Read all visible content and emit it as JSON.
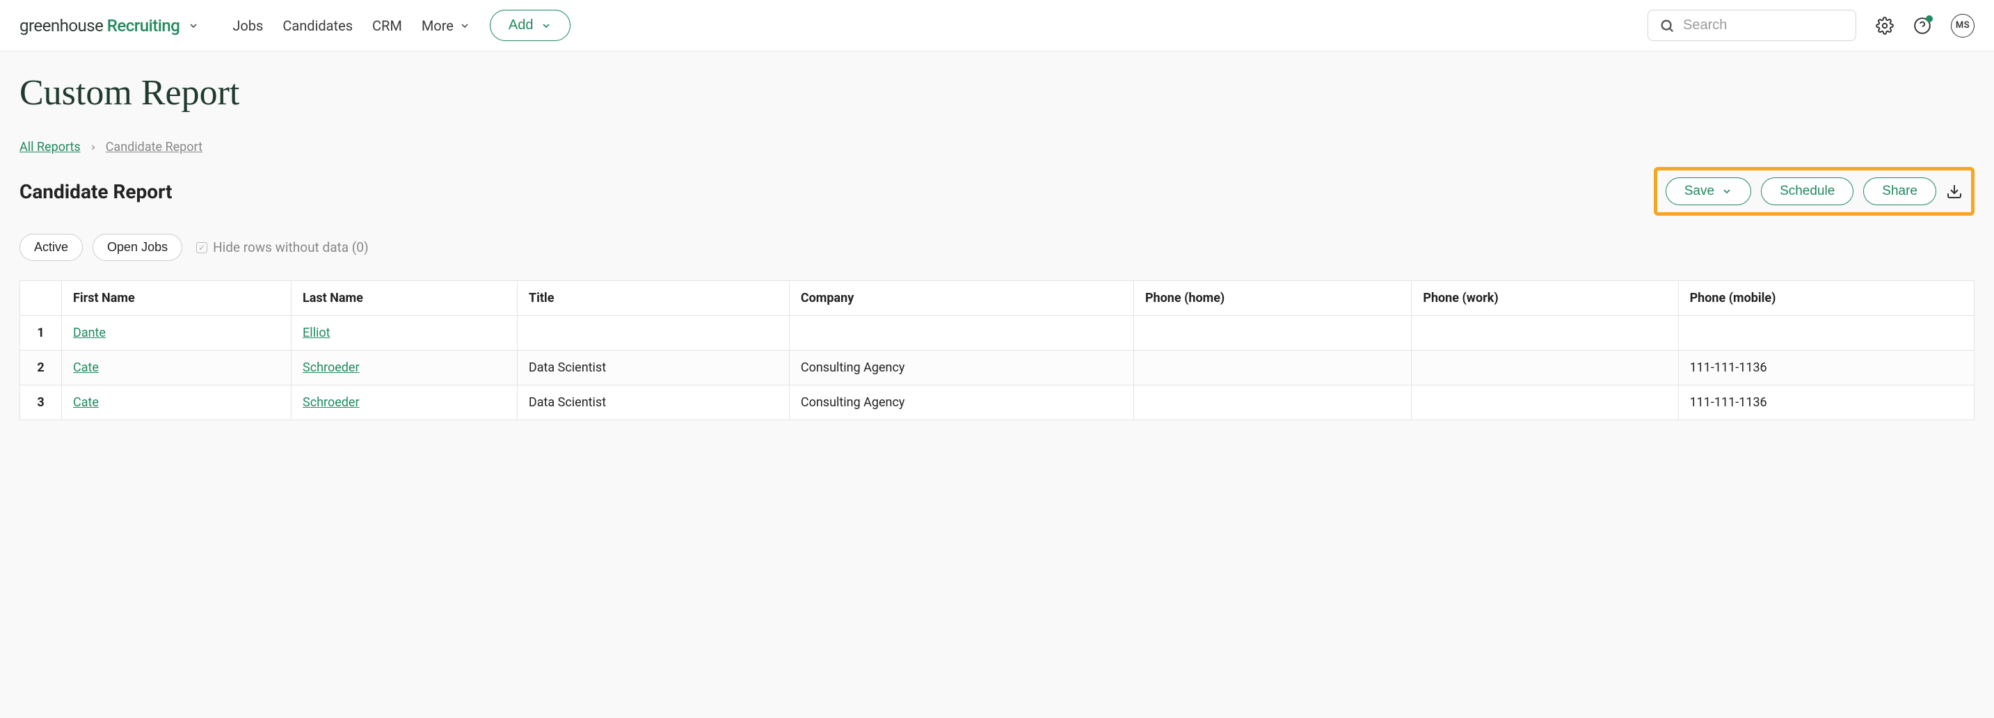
{
  "header": {
    "logo_dark": "greenhouse",
    "logo_green": "Recruiting",
    "nav": [
      "Jobs",
      "Candidates",
      "CRM",
      "More"
    ],
    "add_label": "Add",
    "search_placeholder": "Search",
    "avatar_initials": "MS"
  },
  "page": {
    "title": "Custom Report",
    "breadcrumbs": {
      "root": "All Reports",
      "current": "Candidate Report"
    },
    "subtitle": "Candidate Report",
    "actions": {
      "save": "Save",
      "schedule": "Schedule",
      "share": "Share"
    },
    "filters": {
      "pill1": "Active",
      "pill2": "Open Jobs",
      "hide_rows": "Hide rows without data (0)"
    }
  },
  "table": {
    "headers": [
      "",
      "First Name",
      "Last Name",
      "Title",
      "Company",
      "Phone (home)",
      "Phone (work)",
      "Phone (mobile)"
    ],
    "rows": [
      {
        "n": "1",
        "first": "Dante",
        "last": "Elliot",
        "title": "",
        "company": "",
        "ph_home": "",
        "ph_work": "",
        "ph_mobile": ""
      },
      {
        "n": "2",
        "first": "Cate",
        "last": "Schroeder",
        "title": "Data Scientist",
        "company": "Consulting Agency",
        "ph_home": "",
        "ph_work": "",
        "ph_mobile": "111-111-1136"
      },
      {
        "n": "3",
        "first": "Cate",
        "last": "Schroeder",
        "title": "Data Scientist",
        "company": "Consulting Agency",
        "ph_home": "",
        "ph_work": "",
        "ph_mobile": "111-111-1136"
      }
    ]
  }
}
